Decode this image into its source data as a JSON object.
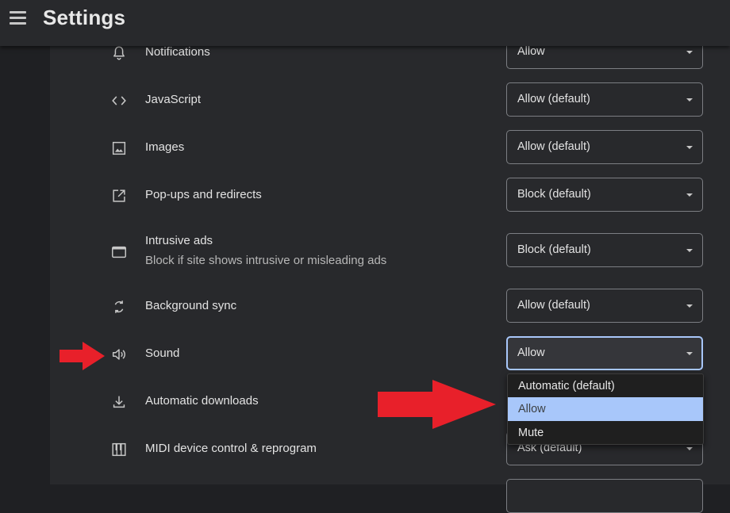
{
  "header": {
    "title": "Settings",
    "menu_icon": "hamburger-menu-icon"
  },
  "permissions": [
    {
      "icon": "bell-icon",
      "label": "Notifications",
      "value": "Allow"
    },
    {
      "icon": "code-icon",
      "label": "JavaScript",
      "value": "Allow (default)"
    },
    {
      "icon": "image-icon",
      "label": "Images",
      "value": "Allow (default)"
    },
    {
      "icon": "open-in-new-icon",
      "label": "Pop-ups and redirects",
      "value": "Block (default)"
    },
    {
      "icon": "web-asset-icon",
      "label": "Intrusive ads",
      "description": "Block if site shows intrusive or misleading ads",
      "value": "Block (default)"
    },
    {
      "icon": "sync-icon",
      "label": "Background sync",
      "value": "Allow (default)"
    },
    {
      "icon": "speaker-icon",
      "label": "Sound",
      "value": "Allow"
    },
    {
      "icon": "download-icon",
      "label": "Automatic downloads",
      "value": ""
    },
    {
      "icon": "piano-icon",
      "label": "MIDI device control & reprogram",
      "value": "Ask (default)"
    }
  ],
  "sound_dropdown": {
    "options": [
      "Automatic (default)",
      "Allow",
      "Mute"
    ],
    "selected": "Allow"
  },
  "colors": {
    "background": "#1f2023",
    "panel": "#28292c",
    "focus_ring": "#a8c7fa",
    "highlight": "#a8c7fa",
    "annotation_arrow": "#e8202a"
  }
}
